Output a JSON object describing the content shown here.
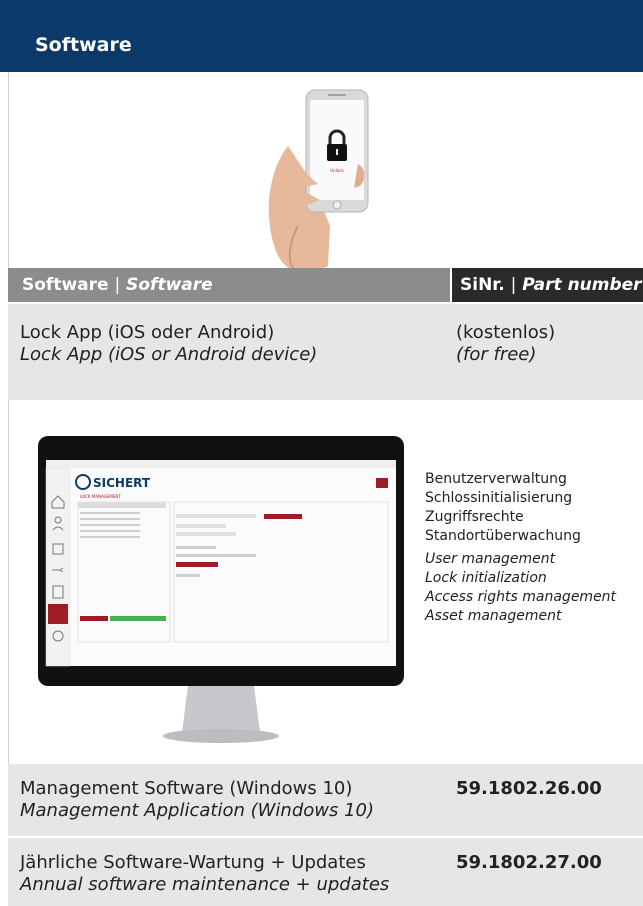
{
  "header": {
    "title": "Software"
  },
  "table_header": {
    "software_de": "Software",
    "separator": "|",
    "software_en": "Software",
    "part_de": "SiNr.",
    "part_en": "Part number"
  },
  "lock_app_screen": {
    "status_text": "Unlock"
  },
  "rows": [
    {
      "name_de": "Lock App (iOS oder Android)",
      "name_en": "Lock App (iOS or Android device)",
      "part_de": "(kostenlos)",
      "part_en": "(for free)"
    },
    {
      "name_de": "Management Software (Windows 10)",
      "name_en": "Management Application (Windows 10)",
      "part": "59.1802.26.00"
    },
    {
      "name_de": "Jährliche Software-Wartung + Updates",
      "name_en": "Annual software maintenance + updates",
      "part": "59.1802.27.00"
    }
  ],
  "monitor_app": {
    "brand": "SICHERT",
    "view_title": "LOCK MANAGEMENT"
  },
  "features": {
    "de": [
      "Benutzerverwaltung",
      "Schlossinitialisierung",
      "Zugriffsrechte",
      "Standortüberwachung"
    ],
    "en": [
      "User management",
      "Lock initialization",
      "Access rights management",
      "Asset management"
    ]
  },
  "colors": {
    "header_blue": "#0b3a6a",
    "column_gray": "#8c8c8c",
    "column_dark": "#2a2a2a",
    "row_gray": "#e6e6e6",
    "brand_red": "#a01c24"
  }
}
